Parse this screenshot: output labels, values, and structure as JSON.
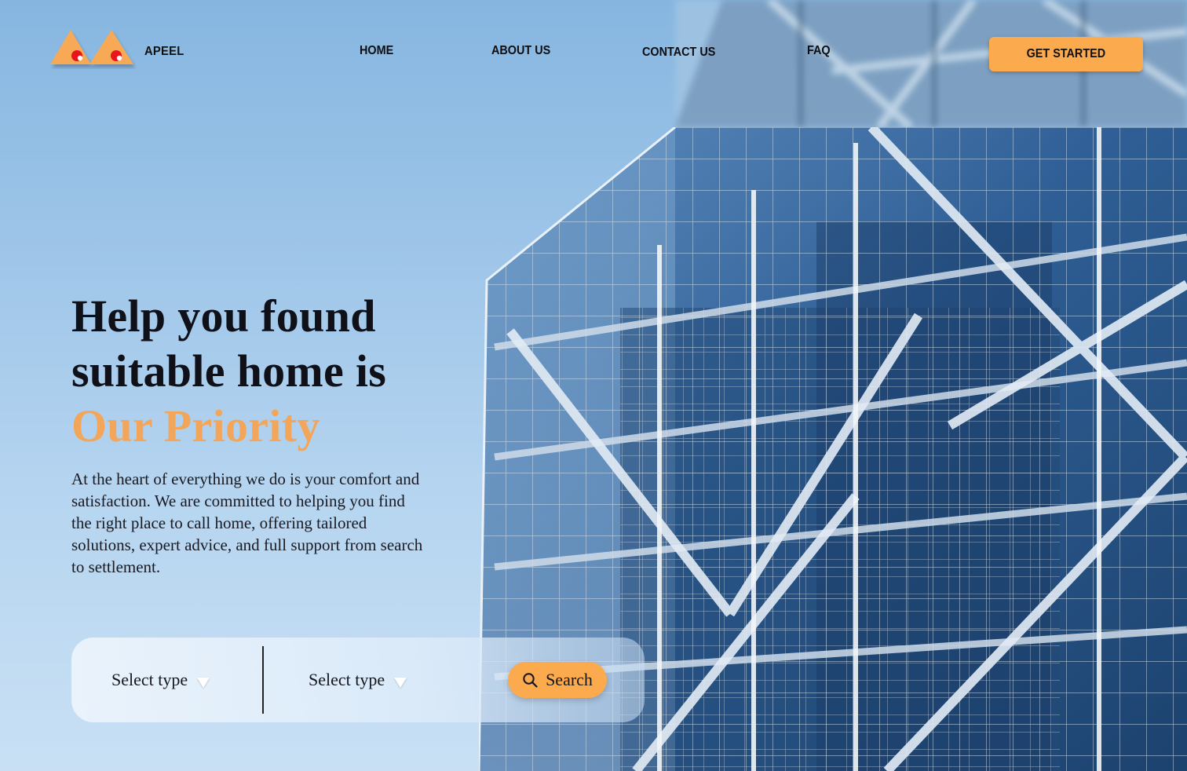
{
  "brand": {
    "name": "APEEL"
  },
  "nav": {
    "home": "HOME",
    "about": "ABOUT US",
    "contact": "CONTACT US",
    "faq": "FAQ"
  },
  "cta": {
    "label": "GET STARTED"
  },
  "hero": {
    "headline_line1": "Help you found",
    "headline_line2": "suitable home is",
    "headline_accent": "Our Priority",
    "description": "At the heart of everything we do is your comfort and satisfaction. We are committed to helping you find the right place to call home, offering tailored solutions, expert advice, and full support from search to settlement."
  },
  "search": {
    "select_1": "Select type",
    "select_2": "Select type",
    "button_label": "Search",
    "icon": "search-icon"
  },
  "colors": {
    "accent": "#fbab4e",
    "headline_accent": "#f3a65a",
    "text": "#101018"
  },
  "background_image": {
    "icon": "glass-building-image"
  }
}
